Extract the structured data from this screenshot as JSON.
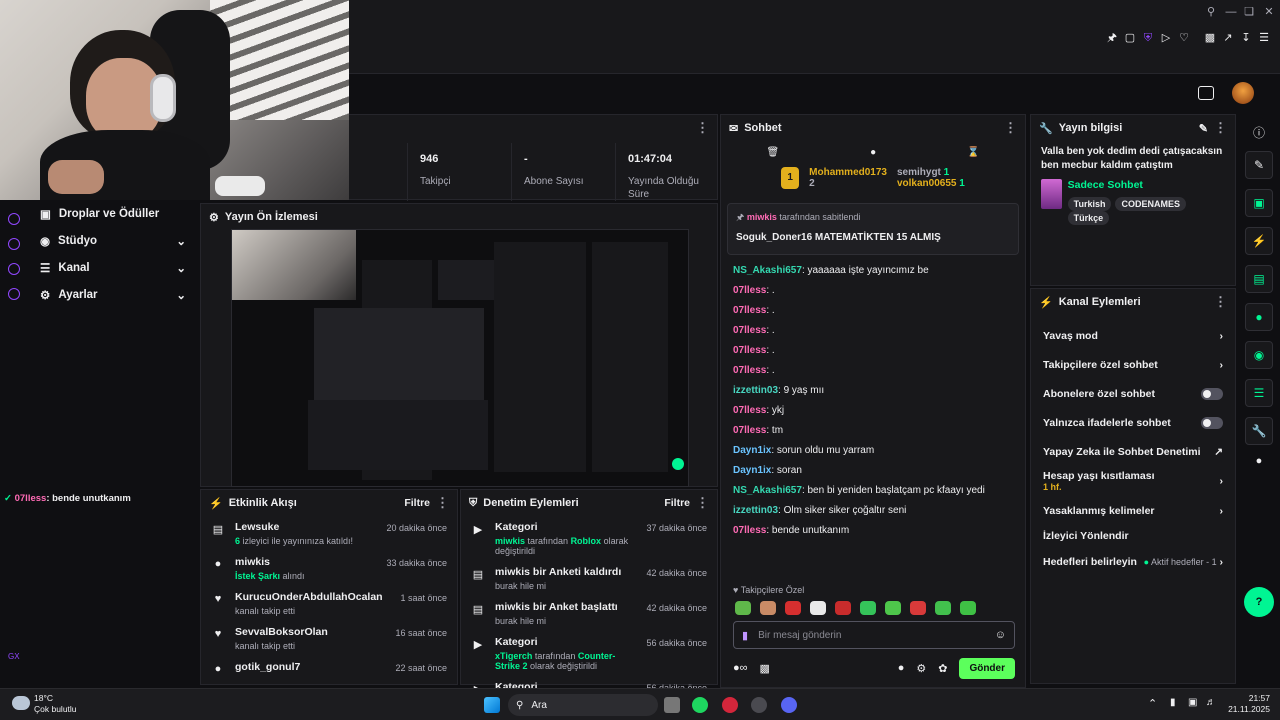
{
  "top": {
    "icons": [
      "search-icon",
      "minimize-icon",
      "restore-icon",
      "close-icon"
    ]
  },
  "stats": {
    "followers_value": "946",
    "followers_label": "Takipçi",
    "subs_value": "-",
    "subs_label": "Abone Sayısı",
    "uptime_value": "01:47:04",
    "uptime_label": "Yayında Olduğu Süre"
  },
  "leftnav": {
    "items": [
      {
        "label": "Droplar ve Ödüller"
      },
      {
        "label": "Stüdyo"
      },
      {
        "label": "Kanal"
      },
      {
        "label": "Ayarlar"
      }
    ],
    "ticker_user": "07lless",
    "ticker_text": ": bende unutkanım"
  },
  "preview": {
    "title": "Yayın Ön İzlemesi"
  },
  "activity": {
    "title": "Etkinlik Akışı",
    "filter": "Filtre",
    "items": [
      {
        "user": "Lewsuke",
        "detail_pre": "",
        "detail_hl": "6",
        "detail_post": " izleyici ile yayınınıza katıldı!",
        "time": "20 dakika önce"
      },
      {
        "user": "miwkis",
        "detail_pre": "",
        "detail_hl": "İstek Şarkı",
        "detail_post": " alındı",
        "time": "33 dakika önce"
      },
      {
        "user": "KurucuOnderAbdullahOcalan",
        "detail_pre": "",
        "detail_hl": "",
        "detail_post": "kanalı takip etti",
        "time": "1 saat önce"
      },
      {
        "user": "SevvalBoksorOlan",
        "detail_pre": "",
        "detail_hl": "",
        "detail_post": "kanalı takip etti",
        "time": "16 saat önce"
      },
      {
        "user": "gotik_gonul7",
        "detail_pre": "",
        "detail_hl": "",
        "detail_post": "",
        "time": "22 saat önce"
      }
    ]
  },
  "mod": {
    "title": "Denetim Eylemleri",
    "filter": "Filtre",
    "items": [
      {
        "title": "Kategori",
        "d1": "miwkis",
        "d2": " tarafından ",
        "d3": "Roblox",
        "d4": " olarak değiştirildi",
        "time": "37 dakika önce"
      },
      {
        "title": "miwkis bir Anketi kaldırdı",
        "d1": "",
        "d2": "burak hile mi",
        "d3": "",
        "d4": "",
        "time": "42 dakika önce"
      },
      {
        "title": "miwkis bir Anket başlattı",
        "d1": "",
        "d2": "burak hile mi",
        "d3": "",
        "d4": "",
        "time": "42 dakika önce"
      },
      {
        "title": "Kategori",
        "d1": "xTigerch",
        "d2": " tarafından ",
        "d3": "Counter-Strike 2",
        "d4": " olarak değiştirildi",
        "time": "56 dakika önce"
      },
      {
        "title": "Kategori",
        "d1": "",
        "d2": "",
        "d3": "",
        "d4": "",
        "time": "56 dakika önce"
      }
    ]
  },
  "chat": {
    "title": "Sohbet",
    "top1_name": "Mohammed0173",
    "top1_count": "2",
    "top2_name": "semihygt",
    "top2_count": "1",
    "top3_name": "volkan00655",
    "top3_count": "1",
    "pinned_by": "miwkis",
    "pinned_suffix": " tarafından sabitlendi",
    "pinned_text": "Soguk_Doner16 MATEMATİKTEN 15 ALMIŞ",
    "messages": [
      {
        "user": "NS_Akashi657",
        "text": ": yaaaaaa işte yayıncımız be",
        "cls": "c3"
      },
      {
        "user": "07lless",
        "text": ": .",
        "cls": "c1"
      },
      {
        "user": "07lless",
        "text": ": .",
        "cls": "c1"
      },
      {
        "user": "07lless",
        "text": ": .",
        "cls": "c1"
      },
      {
        "user": "07lless",
        "text": ": .",
        "cls": "c1"
      },
      {
        "user": "07lless",
        "text": ": .",
        "cls": "c1"
      },
      {
        "user": "izzettin03",
        "text": ": 9 yaş mıı",
        "cls": "c4"
      },
      {
        "user": "07lless",
        "text": ": ykj",
        "cls": "c1"
      },
      {
        "user": "07lless",
        "text": ": tm",
        "cls": "c1"
      },
      {
        "user": "Dayn1ix",
        "text": ": sorun oldu mu yarram",
        "cls": "c2"
      },
      {
        "user": "Dayn1ix",
        "text": ": soran",
        "cls": "c2"
      },
      {
        "user": "NS_Akashi657",
        "text": ": ben bi yeniden başlatçam pc kfaayı yedi",
        "cls": "c3"
      },
      {
        "user": "izzettin03",
        "text": ": Olm siker siker çoğaltır seni",
        "cls": "c4"
      },
      {
        "user": "07lless",
        "text": ": bende unutkanım",
        "cls": "c1"
      }
    ],
    "emote_label": "Takipçilere Özel",
    "input_placeholder": "Bir mesaj gönderin",
    "send": "Gönder"
  },
  "info": {
    "title": "Yayın bilgisi",
    "stream_title": "Valla ben yok dedim dedi çatışacaksın ben mecbur kaldım çatıştım",
    "category": "Sadece Sohbet",
    "tags": [
      "Turkish",
      "CODENAMES",
      "Türkçe"
    ]
  },
  "actions": {
    "title": "Kanal Eylemleri",
    "items": [
      {
        "label": "Yavaş mod"
      },
      {
        "label": "Takipçilere özel sohbet"
      },
      {
        "label": "Abonelere özel sohbet"
      },
      {
        "label": "Yalnızca ifadelerle sohbet"
      },
      {
        "label": "Yapay Zeka ile Sohbet Denetimi"
      },
      {
        "label": "Hesap yaşı kısıtlaması",
        "sub": "1 hf."
      },
      {
        "label": "Yasaklanmış kelimeler"
      },
      {
        "label": "İzleyici Yönlendir"
      },
      {
        "label": "Hedefleri belirleyin",
        "extra": "Aktif hedefler - 1"
      }
    ]
  },
  "taskbar": {
    "temp": "18°C",
    "weather": "Çok bulutlu",
    "search": "Ara",
    "time": "21:57",
    "date": "21.11.2025"
  },
  "colors": {
    "accent": "#9147ff",
    "send": "#5cff5c",
    "green": "#00f593"
  }
}
